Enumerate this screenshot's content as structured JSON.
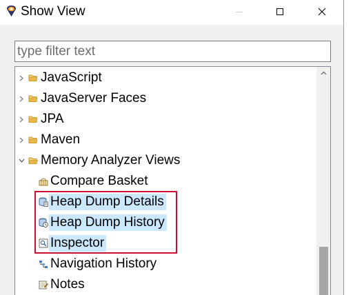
{
  "dialog": {
    "title": "Show View",
    "icon": "eclipse-icon"
  },
  "window_controls": {
    "minimize": "minimize-icon",
    "maximize": "maximize-icon",
    "close": "close-icon"
  },
  "filter": {
    "placeholder": "type filter text",
    "value": ""
  },
  "tree": {
    "items": [
      {
        "label": "JavaScript",
        "type": "category",
        "expanded": false,
        "icon": "folder-icon"
      },
      {
        "label": "JavaServer Faces",
        "type": "category",
        "expanded": false,
        "icon": "folder-icon"
      },
      {
        "label": "JPA",
        "type": "category",
        "expanded": false,
        "icon": "folder-icon"
      },
      {
        "label": "Maven",
        "type": "category",
        "expanded": false,
        "icon": "folder-icon"
      },
      {
        "label": "Memory Analyzer Views",
        "type": "category",
        "expanded": true,
        "icon": "open-folder-icon"
      },
      {
        "label": "Compare Basket",
        "type": "view",
        "selected": false,
        "icon": "compare-basket-icon"
      },
      {
        "label": "Heap Dump Details",
        "type": "view",
        "selected": true,
        "icon": "heap-dump-details-icon"
      },
      {
        "label": "Heap Dump History",
        "type": "view",
        "selected": true,
        "icon": "heap-dump-history-icon"
      },
      {
        "label": "Inspector",
        "type": "view",
        "selected": true,
        "icon": "inspector-icon"
      },
      {
        "label": "Navigation History",
        "type": "view",
        "selected": false,
        "icon": "navigation-history-icon"
      },
      {
        "label": "Notes",
        "type": "view",
        "selected": false,
        "icon": "notes-icon"
      }
    ]
  },
  "colors": {
    "selection": "#cce8ff",
    "highlight_border": "#c8102e",
    "folder": "#e8b84a"
  }
}
